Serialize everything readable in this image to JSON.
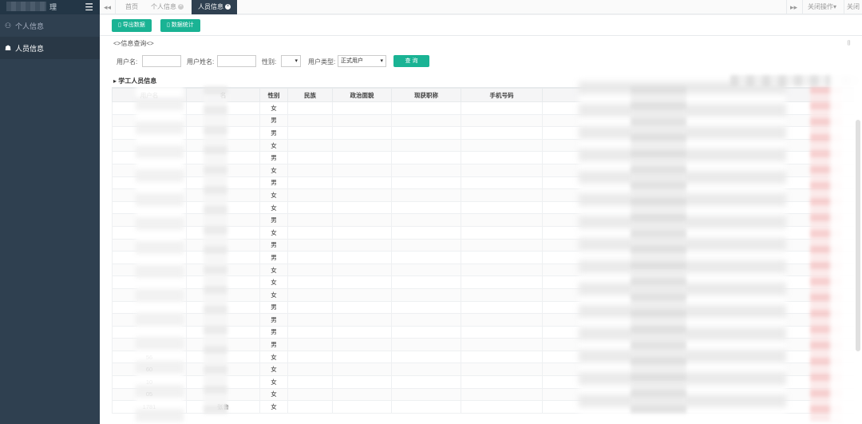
{
  "sidebar": {
    "brand_text": "理",
    "items": [
      {
        "label": "个人信息",
        "icon": "users-icon"
      },
      {
        "label": "人员信息",
        "icon": "user-icon"
      }
    ]
  },
  "tabs": {
    "home": "首页",
    "personal": "个人信息",
    "staff": "人员信息",
    "close_ops": "关闭操作▾",
    "close_all": "关闭"
  },
  "toolbar": {
    "export_label": "导出数据",
    "stats_label": "数据统计"
  },
  "query": {
    "title": "<>信息查询<>",
    "username_label": "用户名:",
    "realname_label": "用户姓名:",
    "gender_label": "性别:",
    "usertype_label": "用户类型:",
    "usertype_value": "正式用户",
    "search_label": "查 询"
  },
  "section_title": "学工人员信息",
  "table": {
    "headers": [
      "用户名",
      "名",
      "性别",
      "民族",
      "政治面貌",
      "现获职称",
      "手机号码"
    ],
    "rows": [
      {
        "username": "",
        "name": "",
        "gender": "女"
      },
      {
        "username": "",
        "name": "",
        "gender": "男"
      },
      {
        "username": "",
        "name": "",
        "gender": "男"
      },
      {
        "username": "",
        "name": "",
        "gender": "女"
      },
      {
        "username": "",
        "name": "",
        "gender": "男"
      },
      {
        "username": "",
        "name": "",
        "gender": "女"
      },
      {
        "username": "",
        "name": "",
        "gender": "男"
      },
      {
        "username": "",
        "name": "",
        "gender": "女"
      },
      {
        "username": "",
        "name": "",
        "gender": "女"
      },
      {
        "username": "",
        "name": "",
        "gender": "男"
      },
      {
        "username": "",
        "name": "",
        "gender": "女"
      },
      {
        "username": "",
        "name": "",
        "gender": "男"
      },
      {
        "username": "",
        "name": "",
        "gender": "男"
      },
      {
        "username": "",
        "name": "",
        "gender": "女"
      },
      {
        "username": "",
        "name": "",
        "gender": "女"
      },
      {
        "username": "",
        "name": "",
        "gender": "女"
      },
      {
        "username": "",
        "name": "",
        "gender": "男"
      },
      {
        "username": "",
        "name": "",
        "gender": "男"
      },
      {
        "username": "",
        "name": "",
        "gender": "男"
      },
      {
        "username": "",
        "name": "",
        "gender": "男"
      },
      {
        "username": "56",
        "name": "",
        "gender": "女"
      },
      {
        "username": "60",
        "name": "",
        "gender": "女"
      },
      {
        "username": "10",
        "name": "",
        "gender": "女"
      },
      {
        "username": "05",
        "name": "",
        "gender": "女"
      },
      {
        "username": "1781",
        "name": "张鲁",
        "gender": "女"
      }
    ]
  },
  "colors": {
    "sidebar_bg": "#2f4050",
    "accent": "#1ab394"
  }
}
